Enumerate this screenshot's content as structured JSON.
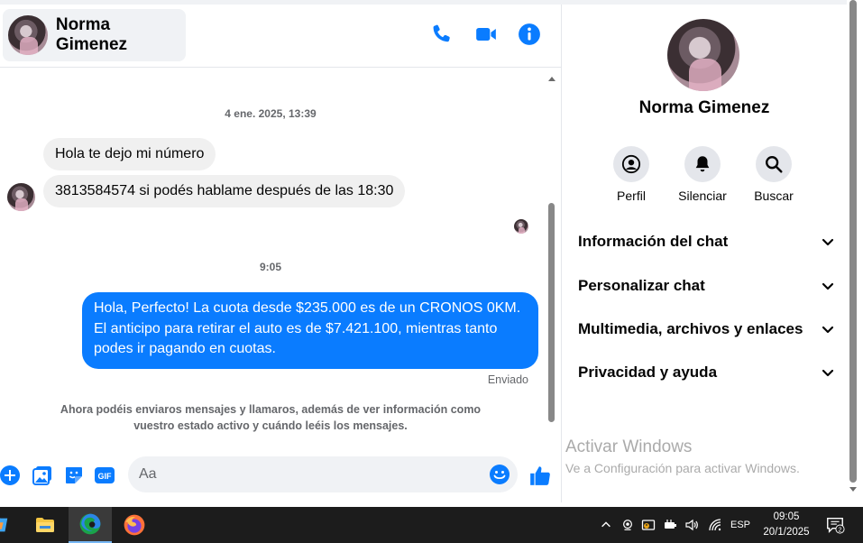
{
  "contact": {
    "name": "Norma Gimenez"
  },
  "conversation": {
    "timestamp_1": "4 ene. 2025, 13:39",
    "incoming_1": "Hola te dejo mi número",
    "incoming_2": "3813584574 si podés hablame después de las 18:30",
    "timestamp_2": "9:05",
    "outgoing_1": "Hola, Perfecto! La cuota desde $235.000 es de un CRONOS 0KM. El anticipo para retirar el auto es de $7.421.100, mientras tanto podes ir pagando en cuotas.",
    "status": "Enviado",
    "notice": "Ahora podéis enviaros mensajes y llamaros, además de ver información como vuestro estado activo y cuándo leéis los mensajes."
  },
  "composer": {
    "placeholder": "Aa",
    "gif_label": "GIF"
  },
  "info_panel": {
    "name": "Norma Gimenez",
    "actions": [
      {
        "label": "Perfil",
        "icon": "profile-icon"
      },
      {
        "label": "Silenciar",
        "icon": "bell-icon"
      },
      {
        "label": "Buscar",
        "icon": "search-icon"
      }
    ],
    "sections": [
      "Información del chat",
      "Personalizar chat",
      "Multimedia, archivos y enlaces",
      "Privacidad y ayuda"
    ],
    "watermark_title": "Activar Windows",
    "watermark_subtitle": "Ve a Configuración para activar Windows."
  },
  "taskbar": {
    "language": "ESP",
    "time": "09:05",
    "date": "20/1/2025",
    "notification_count": "2"
  },
  "colors": {
    "accent": "#0a7cff",
    "bubble_in": "#f0f0f0",
    "taskbar": "#1c1c1c"
  }
}
